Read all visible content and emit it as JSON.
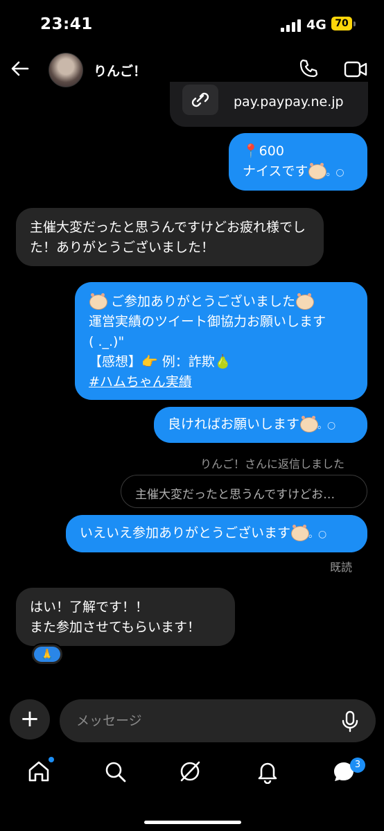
{
  "status": {
    "time": "23:41",
    "network": "4G",
    "battery": "70"
  },
  "header": {
    "contact_name": "りんご！"
  },
  "link_card": {
    "url": "pay.paypay.ne.jp"
  },
  "messages": {
    "m1_line1": "📍600",
    "m1_line2": "ナイスです",
    "m2": "主催大変だったと思うんですけどお疲れ様でした！ありがとうございました！",
    "m3_line1": "ご参加ありがとうございました",
    "m3_line2": "運営実績のツイート御協力お願いします",
    "m3_line3": "( ._.)\"",
    "m3_line4": "【感想】👉 例：詐欺🍐",
    "m3_tag": "#ハムちゃん実績",
    "m4": "良ければお願いします",
    "reply_note": "りんご！さんに返信しました",
    "reply_quote": "主催大変だったと思うんですけどお…",
    "m5": "いえいえ参加ありがとうございます",
    "read_receipt": "既読",
    "m6": "はい！了解です！！\nまた参加させてもらいます！",
    "reaction": "🙏",
    "circles": "。○"
  },
  "composer": {
    "placeholder": "メッセージ"
  },
  "tabbar": {
    "messages_badge": "3"
  },
  "colors": {
    "outgoing": "#1c8ef5",
    "incoming": "#262626",
    "background": "#000000"
  }
}
